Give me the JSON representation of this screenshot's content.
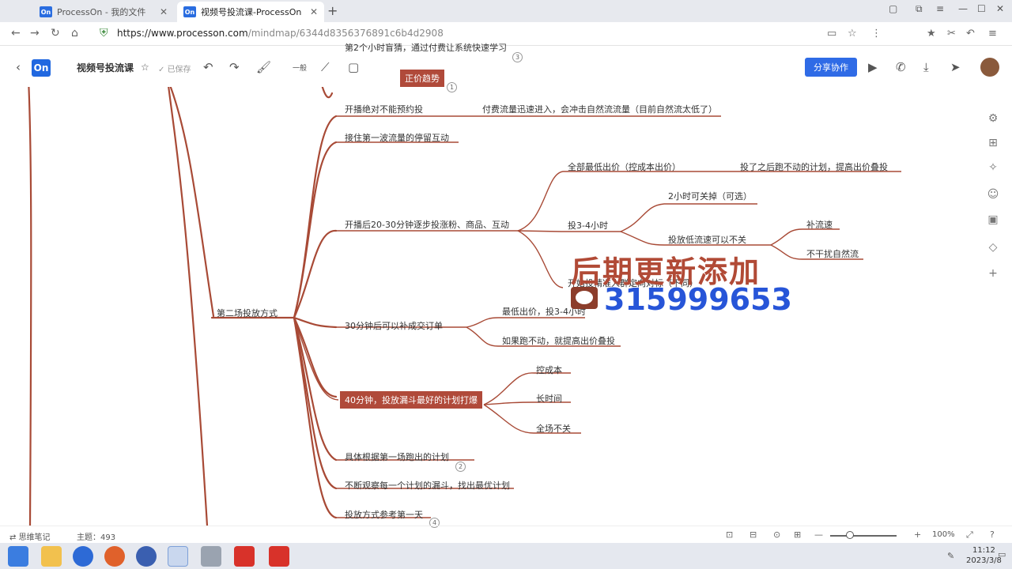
{
  "browser": {
    "tabs": [
      {
        "title": "ProcessOn - 我的文件",
        "favicon": "On"
      },
      {
        "title": "视频号投流课-ProcessOn",
        "favicon": "On"
      }
    ],
    "url_domain": "https://www.processon.com",
    "url_path": "/mindmap/6344d8356376891c6b4d2908"
  },
  "app": {
    "logo": "On",
    "title": "视频号投流课",
    "saved": "已保存",
    "style_label": "一般",
    "share_label": "分享协作"
  },
  "mindmap": {
    "top_truncated_1": "第2个小时盲猜，通过付费让系统快速学习",
    "top_truncated_2": "正价趋势",
    "top_badge_1": "3",
    "top_badge_2": "1",
    "root": "第二场投放方式",
    "n1": "开播绝对不能预约投",
    "n1_sub": "付费流量迅速进入，会冲击自然流流量（目前自然流太低了）",
    "n2": "接住第一波流量的停留互动",
    "n3": "开播后20-30分钟逐步投涨粉、商品、互动",
    "n3a": "全部最低出价（控成本出价）",
    "n3a1": "投了之后跑不动的计划，提高出价叠投",
    "n3b": "投3-4小时",
    "n3b1": "2小时可关掉（可选）",
    "n3b2": "投放低流速可以不关",
    "n3b2a": "补流速",
    "n3b2b": "不干扰自然流",
    "n3c": "开始投精准人群定向对标（下同）",
    "n4": "30分钟后可以补成交订单",
    "n4a": "最低出价，投3-4小时",
    "n4b": "如果跑不动，就提高出价叠投",
    "n5": "40分钟，投放漏斗最好的计划打爆",
    "n5a": "控成本",
    "n5b": "长时间",
    "n5c": "全场不关",
    "n6": "具体根据第一场跑出的计划",
    "n6_badge": "2",
    "n7": "不断观察每一个计划的漏斗，找出最优计划",
    "n8": "投放方式参考第一天",
    "n8_badge": "4"
  },
  "watermark": {
    "line1": "后期更新添加",
    "line2": "315999653"
  },
  "status": {
    "notes": "思维笔记",
    "topics": "主题：493",
    "zoom": "100%"
  },
  "taskbar": {
    "time": "11:12",
    "date": "2023/3/8"
  },
  "colors": {
    "branch": "#a84a36",
    "highlight": "#b04a3a",
    "accent": "#2f6be6",
    "watermark_red": "#b14a36",
    "watermark_blue": "#2755d8"
  }
}
